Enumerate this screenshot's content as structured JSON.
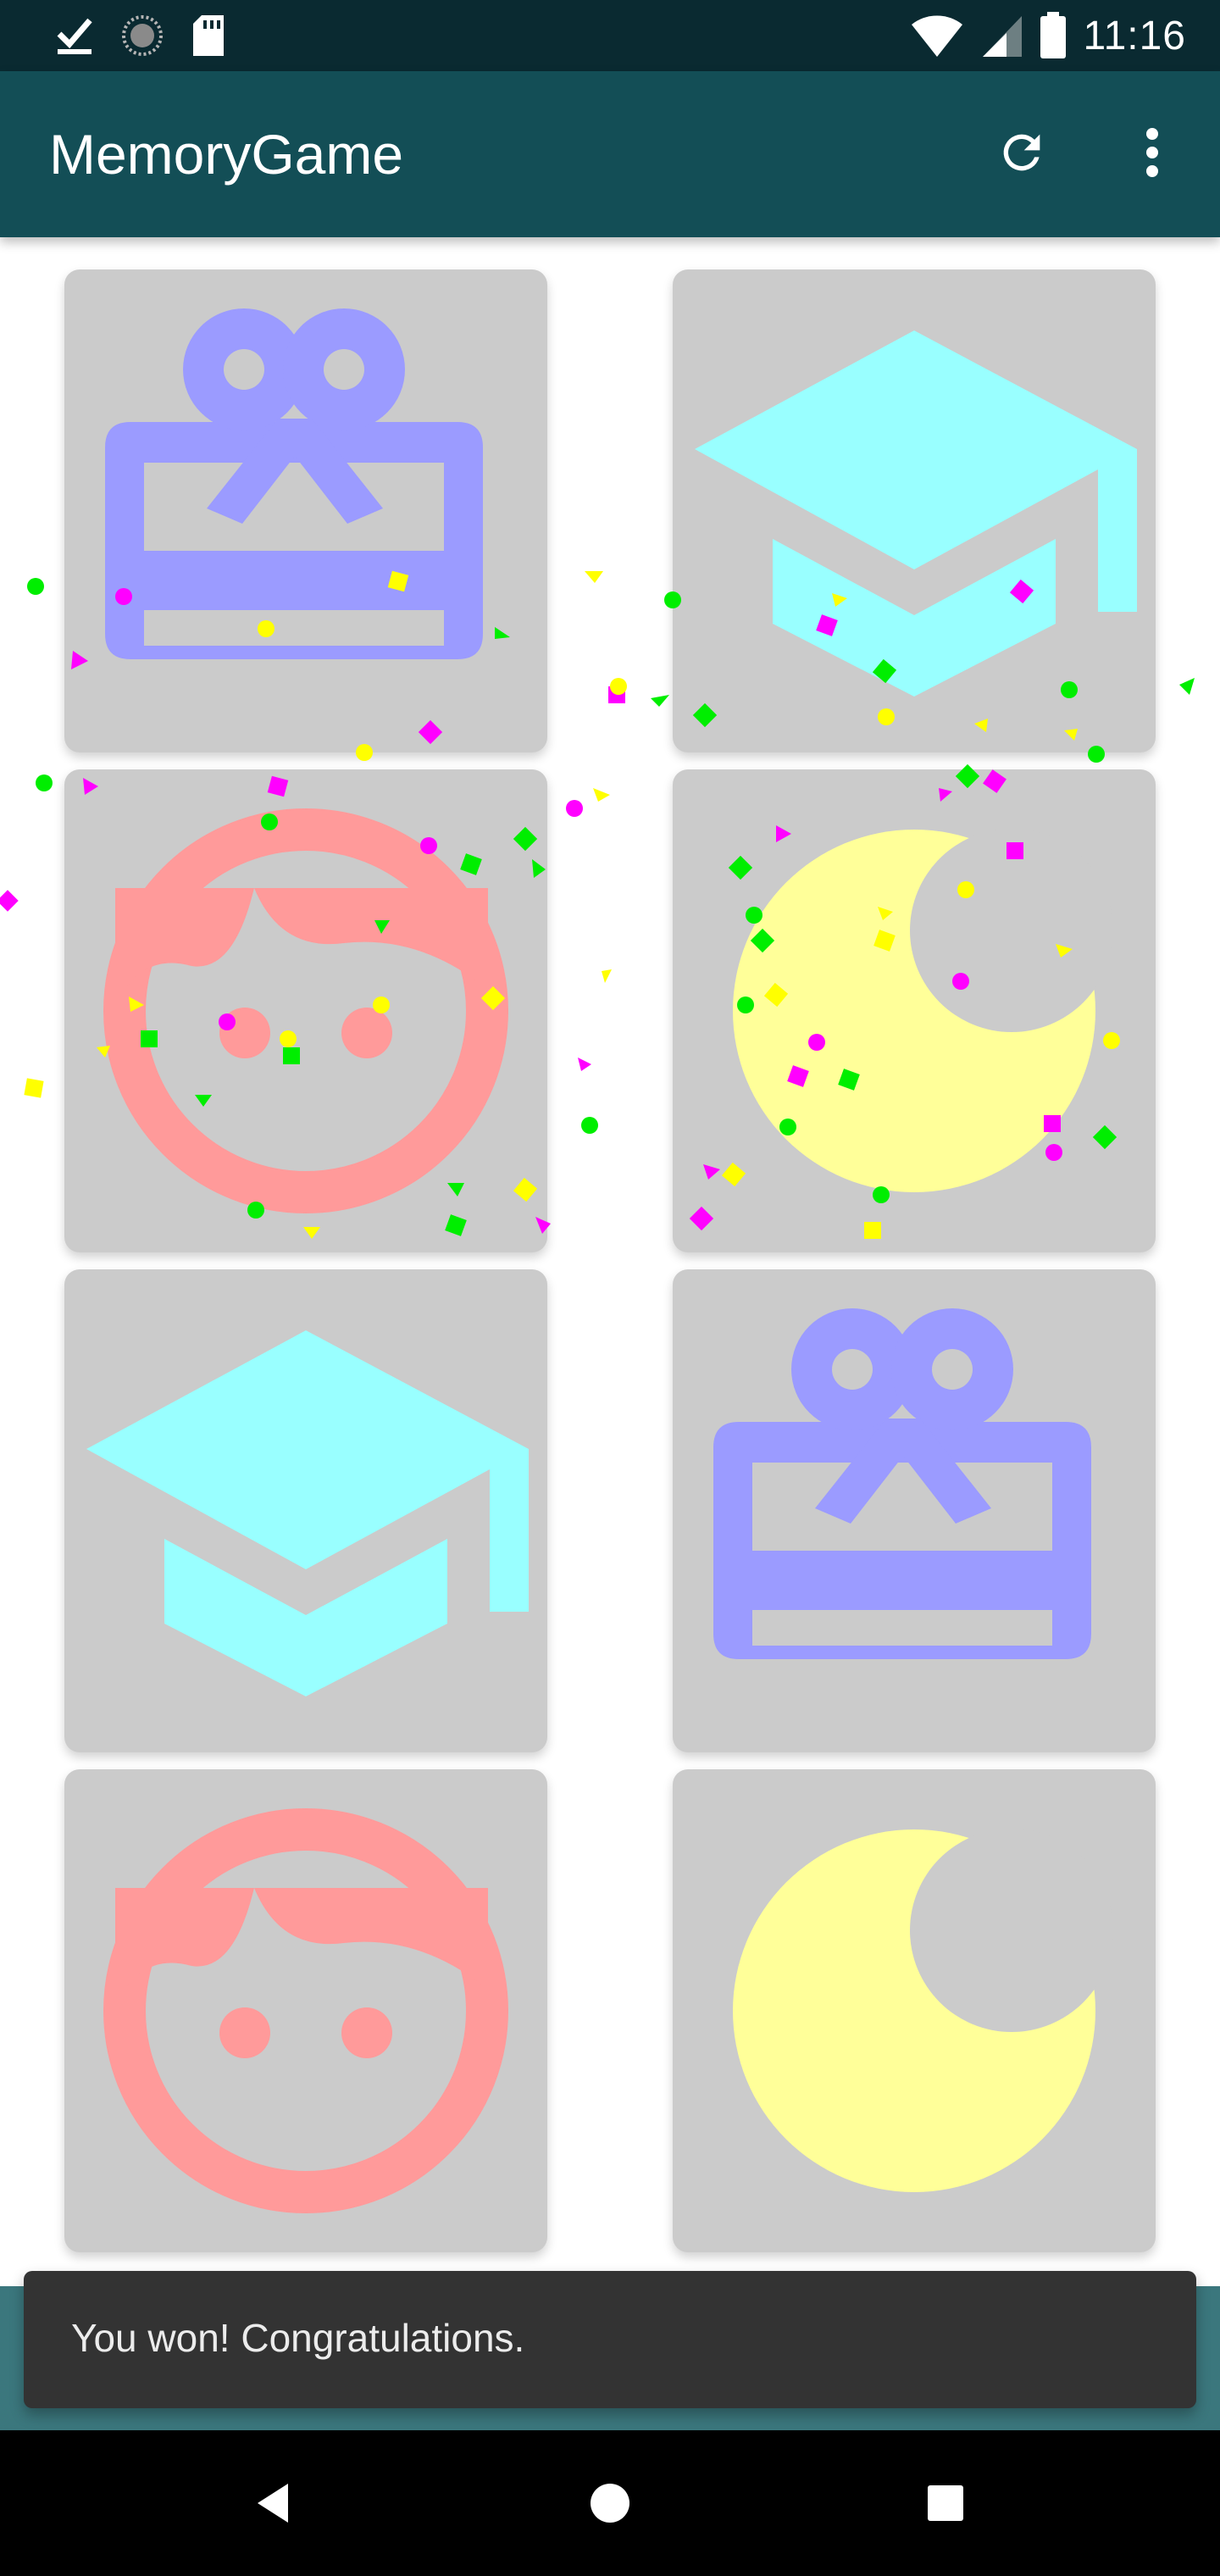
{
  "status_bar": {
    "time": "11:16",
    "left_icons": [
      "check-download-icon",
      "sync-icon",
      "sd-card-icon"
    ],
    "right_icons": [
      "wifi-icon",
      "cellular-icon",
      "battery-icon"
    ]
  },
  "app_bar": {
    "title": "MemoryGame",
    "actions": [
      "refresh-icon",
      "overflow-menu-icon"
    ]
  },
  "board": {
    "cards": [
      {
        "icon": "gift-card-icon",
        "color": "#9b9bff"
      },
      {
        "icon": "graduation-cap-icon",
        "color": "#99ffff"
      },
      {
        "icon": "face-icon",
        "color": "#ff9a9a"
      },
      {
        "icon": "moon-icon",
        "color": "#ffff99"
      },
      {
        "icon": "graduation-cap-icon",
        "color": "#99ffff"
      },
      {
        "icon": "gift-card-icon",
        "color": "#9b9bff"
      },
      {
        "icon": "face-icon",
        "color": "#ff9a9a"
      },
      {
        "icon": "moon-icon",
        "color": "#ffff99"
      }
    ],
    "card_color": "#cbcbcb"
  },
  "snackbar": {
    "message": "You won! Congratulations."
  },
  "colors": {
    "status_bar": "#0a2a31",
    "app_bar": "#134e56",
    "confetti": [
      "#ff00ff",
      "#00ee00",
      "#ffff00"
    ]
  },
  "nav_bar": {
    "buttons": [
      "back-icon",
      "home-icon",
      "recents-icon"
    ]
  }
}
